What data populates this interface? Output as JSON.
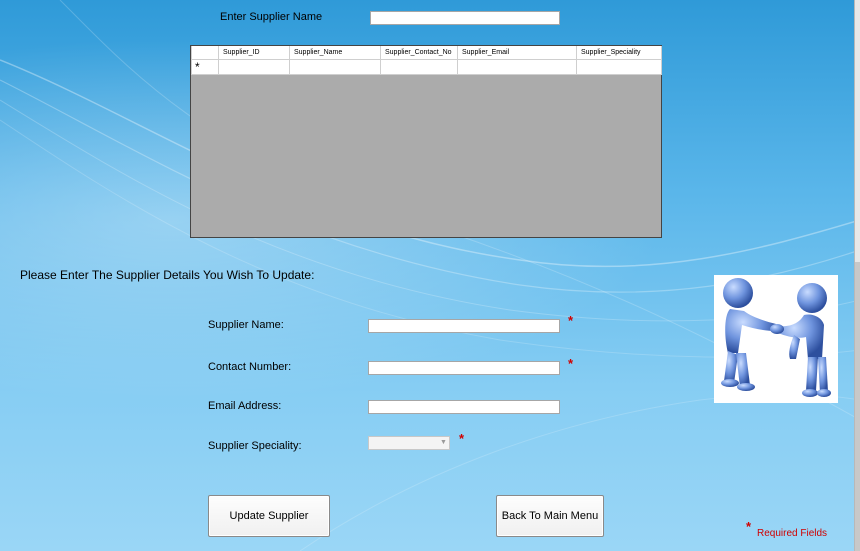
{
  "search": {
    "label": "Enter Supplier Name",
    "value": ""
  },
  "grid": {
    "columns": [
      "Supplier_ID",
      "Supplier_Name",
      "Supplier_Contact_No",
      "Supplier_Email",
      "Supplier_Speciality"
    ],
    "new_row_marker": "*"
  },
  "section_title": "Please Enter The Supplier Details You Wish To Update:",
  "form": {
    "supplier_name_label": "Supplier Name:",
    "supplier_name_value": "",
    "contact_number_label": "Contact Number:",
    "contact_number_value": "",
    "email_label": "Email Address:",
    "email_value": "",
    "speciality_label": "Supplier Speciality:",
    "speciality_value": ""
  },
  "required_marker": "*",
  "required_note": "Required Fields",
  "buttons": {
    "update": "Update Supplier",
    "back": "Back To Main Menu"
  },
  "colors": {
    "required": "#d00000",
    "grid_background": "#ababab"
  },
  "picture_icon": "handshake-people-icon"
}
